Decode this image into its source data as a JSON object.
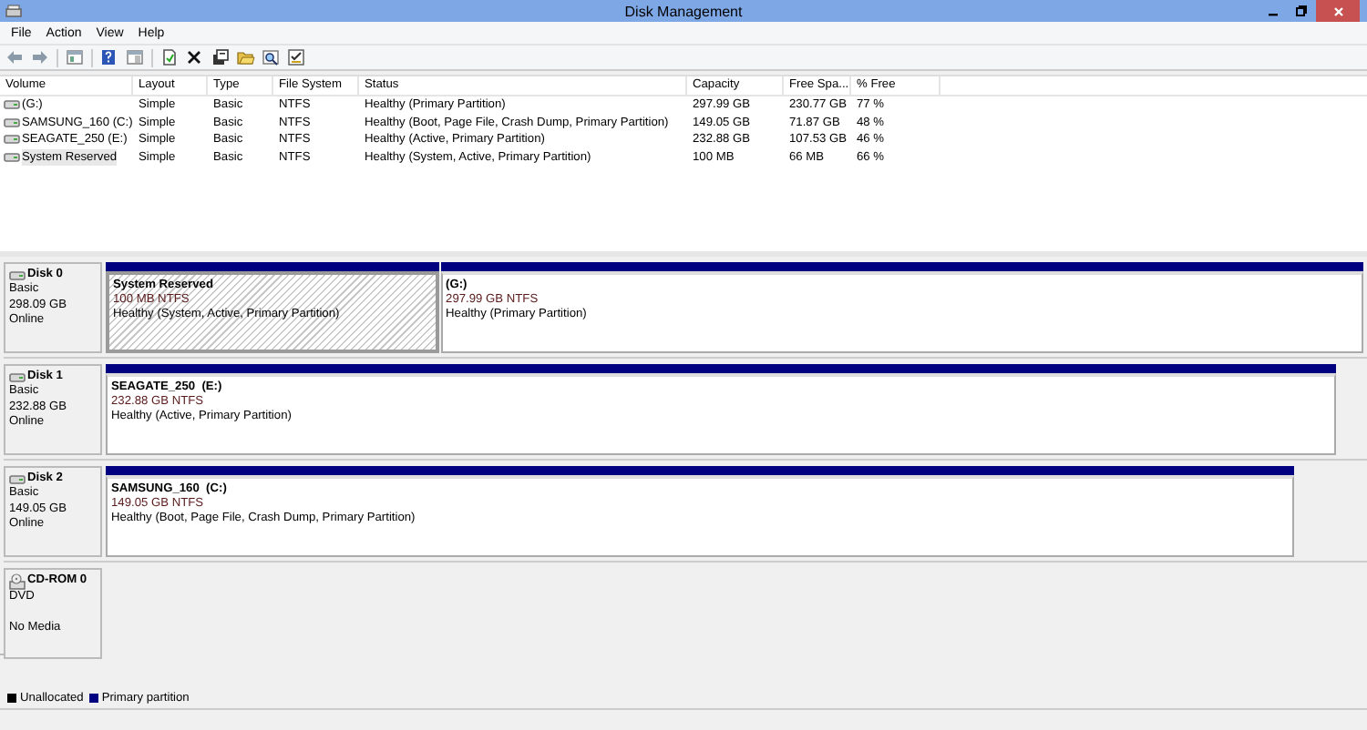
{
  "window": {
    "title": "Disk Management"
  },
  "menu": [
    "File",
    "Action",
    "View",
    "Help"
  ],
  "volume_table": {
    "columns": [
      "Volume",
      "Layout",
      "Type",
      "File System",
      "Status",
      "Capacity",
      "Free Spa...",
      "% Free"
    ],
    "rows": [
      {
        "volume": "(G:)",
        "layout": "Simple",
        "type": "Basic",
        "file_system": "NTFS",
        "status": "Healthy (Primary Partition)",
        "capacity": "297.99 GB",
        "free_space": "230.77 GB",
        "percent_free": "77 %",
        "selected": false
      },
      {
        "volume": "SAMSUNG_160 (C:)",
        "layout": "Simple",
        "type": "Basic",
        "file_system": "NTFS",
        "status": "Healthy (Boot, Page File, Crash Dump, Primary Partition)",
        "capacity": "149.05 GB",
        "free_space": "71.87 GB",
        "percent_free": "48 %",
        "selected": false
      },
      {
        "volume": "SEAGATE_250 (E:)",
        "layout": "Simple",
        "type": "Basic",
        "file_system": "NTFS",
        "status": "Healthy (Active, Primary Partition)",
        "capacity": "232.88 GB",
        "free_space": "107.53 GB",
        "percent_free": "46 %",
        "selected": false
      },
      {
        "volume": "System Reserved",
        "layout": "Simple",
        "type": "Basic",
        "file_system": "NTFS",
        "status": "Healthy (System, Active, Primary Partition)",
        "capacity": "100 MB",
        "free_space": "66 MB",
        "percent_free": "66 %",
        "selected": true
      }
    ]
  },
  "disks": [
    {
      "kind": "disk",
      "name": "Disk 0",
      "type": "Basic",
      "size": "298.09 GB",
      "state": "Online",
      "partitions": [
        {
          "name": "System Reserved",
          "size_fs": "100 MB NTFS",
          "status": "Healthy (System, Active, Primary Partition)",
          "selected": true
        },
        {
          "name": "(G:)",
          "size_fs": "297.99 GB NTFS",
          "status": "Healthy (Primary Partition)",
          "selected": false
        }
      ]
    },
    {
      "kind": "disk",
      "name": "Disk 1",
      "type": "Basic",
      "size": "232.88 GB",
      "state": "Online",
      "partitions": [
        {
          "name": "SEAGATE_250  (E:)",
          "size_fs": "232.88 GB NTFS",
          "status": "Healthy (Active, Primary Partition)",
          "selected": false
        }
      ]
    },
    {
      "kind": "disk",
      "name": "Disk 2",
      "type": "Basic",
      "size": "149.05 GB",
      "state": "Online",
      "partitions": [
        {
          "name": "SAMSUNG_160  (C:)",
          "size_fs": "149.05 GB NTFS",
          "status": "Healthy (Boot, Page File, Crash Dump, Primary Partition)",
          "selected": false
        }
      ]
    },
    {
      "kind": "cdrom",
      "name": "CD-ROM 0",
      "type": "DVD",
      "state": "No Media"
    }
  ],
  "legend": [
    {
      "label": "Unallocated",
      "color": "#000000"
    },
    {
      "label": "Primary partition",
      "color": "#000080"
    }
  ]
}
